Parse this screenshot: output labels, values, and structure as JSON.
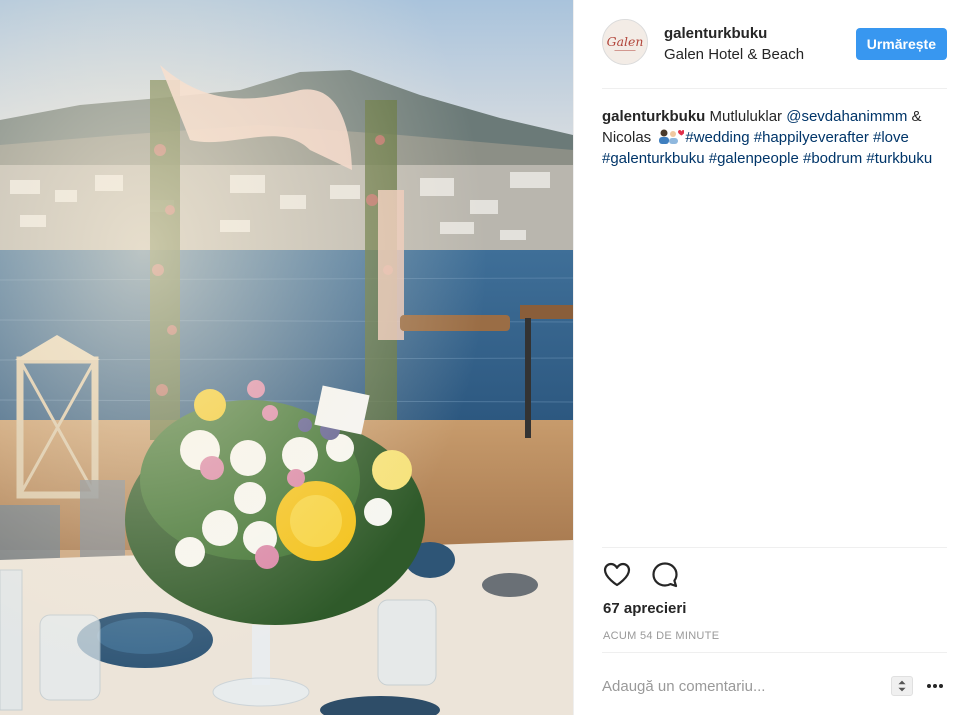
{
  "post": {
    "username": "galenturkbuku",
    "location": "Galen Hotel & Beach",
    "follow_label": "Urmărește",
    "avatar_text": "Galen"
  },
  "caption": {
    "username": "galenturkbuku",
    "text_1": " Mutluluklar ",
    "mention": "@sevdahanimmm",
    "text_2": " & Nicolas ",
    "tags": "#wedding #happilyeverafter #love #galenturkbuku #galenpeople #bodrum #turkbuku"
  },
  "engagement": {
    "likes": "67 aprecieri",
    "timestamp": "ACUM 54 DE MINUTE"
  },
  "comment": {
    "placeholder": "Adaugă un comentariu..."
  },
  "icons": {
    "like": "heart-icon",
    "comment": "comment-bubble-icon",
    "options": "more-options-icon",
    "emoji": "couple-with-heart-icon"
  },
  "colors": {
    "follow_button": "#3897f0",
    "hashtag": "#003569",
    "muted": "#999999"
  }
}
